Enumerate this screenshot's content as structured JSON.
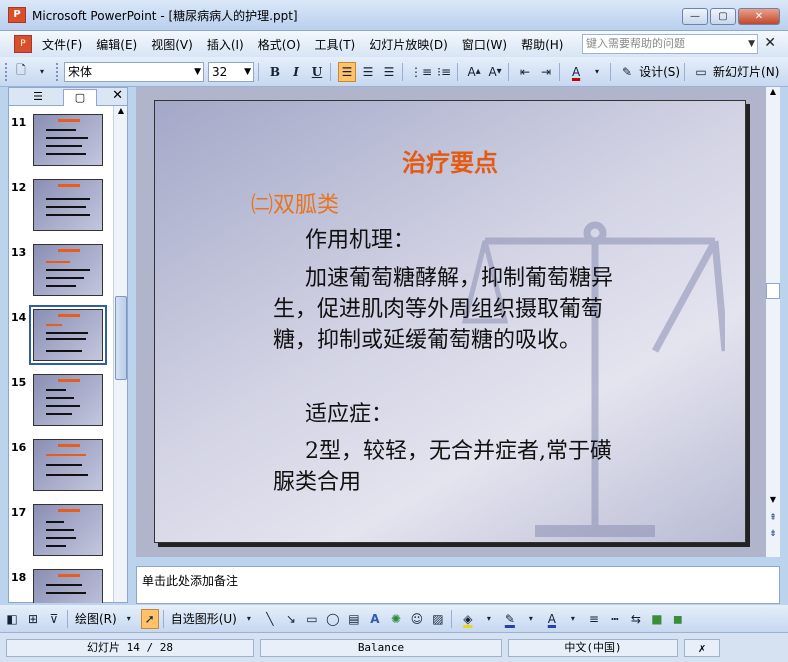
{
  "window": {
    "app_icon_text": "P",
    "title": "Microsoft PowerPoint - [糖尿病病人的护理.ppt]",
    "minimize": "—",
    "maximize": "▢",
    "close": "✕"
  },
  "menubar": {
    "items": [
      "文件(F)",
      "编辑(E)",
      "视图(V)",
      "插入(I)",
      "格式(O)",
      "工具(T)",
      "幻灯片放映(D)",
      "窗口(W)",
      "帮助(H)"
    ],
    "help_placeholder": "键入需要帮助的问题",
    "close": "✕"
  },
  "toolbar": {
    "font_name": "宋体",
    "font_size": "32",
    "bold": "B",
    "italic": "I",
    "underline": "U",
    "design_label": "设计(S)",
    "new_slide_label": "新幻灯片(N)"
  },
  "left_pane": {
    "tabs": [
      "☰",
      "▢"
    ],
    "close": "✕",
    "slides": [
      {
        "number": "11"
      },
      {
        "number": "12"
      },
      {
        "number": "13"
      },
      {
        "number": "14"
      },
      {
        "number": "15"
      },
      {
        "number": "16"
      },
      {
        "number": "17"
      },
      {
        "number": "18"
      }
    ],
    "selected": "14"
  },
  "slide": {
    "title": "治疗要点",
    "subtitle": "㈡双胍类",
    "line1": "作用机理：",
    "line2": "加速葡萄糖酵解，抑制葡萄糖异",
    "line3": "生，促进肌肉等外周组织摄取葡萄",
    "line4": "糖，抑制或延缓葡萄糖的吸收。",
    "line5": "适应症：",
    "line6": "2型，较轻，无合并症者,常于磺",
    "line7": "脲类合用"
  },
  "notes": {
    "placeholder": "单击此处添加备注"
  },
  "drawbar": {
    "draw_label": "绘图(R)",
    "autoshapes_label": "自选图形(U)"
  },
  "status": {
    "slide_info": "幻灯片 14 / 28",
    "design": "Balance",
    "language": "中文(中国)"
  }
}
